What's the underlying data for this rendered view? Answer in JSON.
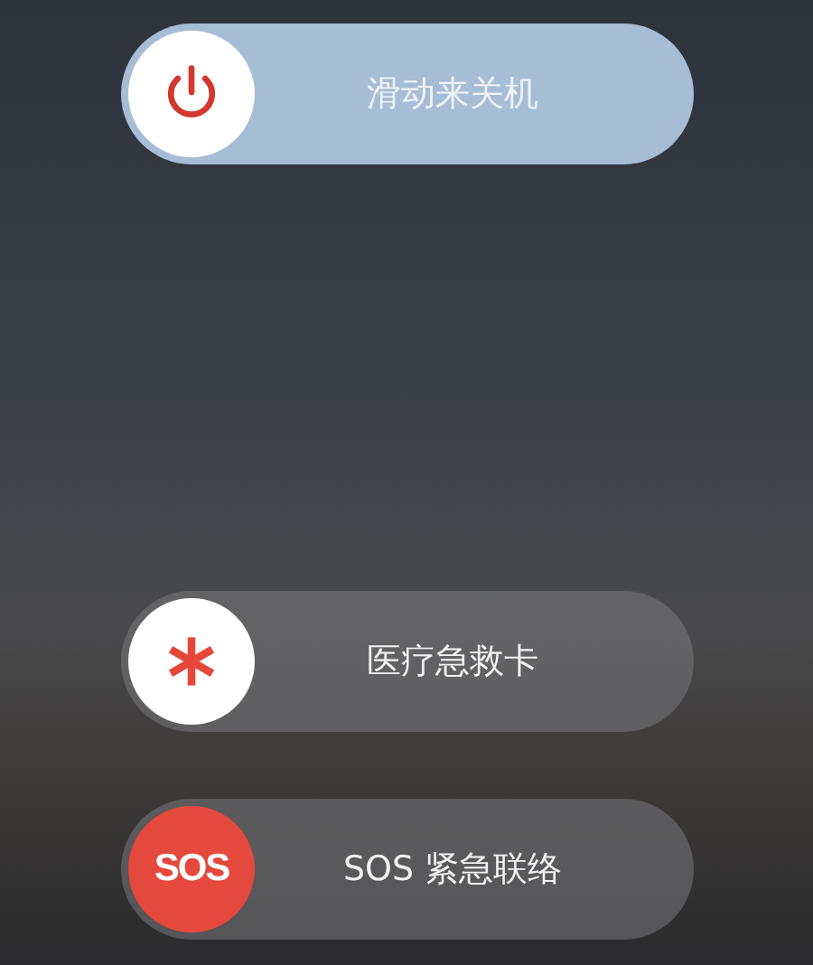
{
  "sliders": [
    {
      "kind": "power",
      "label": "滑动来关机"
    },
    {
      "kind": "medical",
      "label": "医疗急救卡"
    },
    {
      "kind": "sos",
      "knob_text": "SOS",
      "label": "SOS 紧急联络"
    }
  ]
}
